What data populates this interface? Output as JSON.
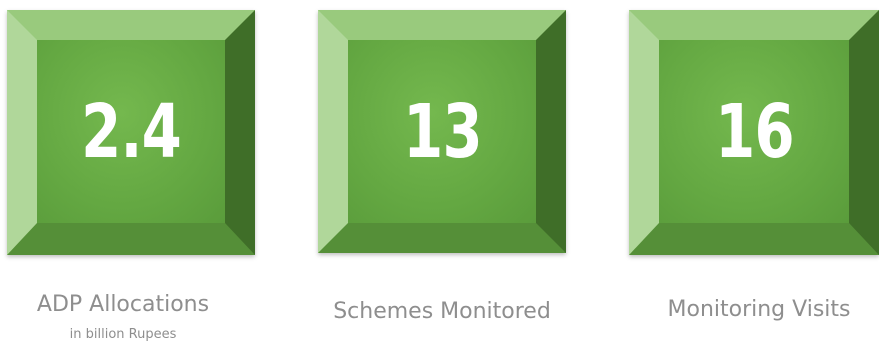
{
  "stats": [
    {
      "value": "2.4",
      "label": "ADP Allocations",
      "sublabel": "in billion Rupees"
    },
    {
      "value": "13",
      "label": "Schemes Monitored"
    },
    {
      "value": "16",
      "label": "Monitoring Visits"
    }
  ],
  "colors": {
    "tile_face": "#64a842",
    "tile_bevel_light": "#b0d79a",
    "tile_bevel_dark": "#3f6e28",
    "value_text": "#ffffff",
    "label_text": "#8e8e8e"
  }
}
